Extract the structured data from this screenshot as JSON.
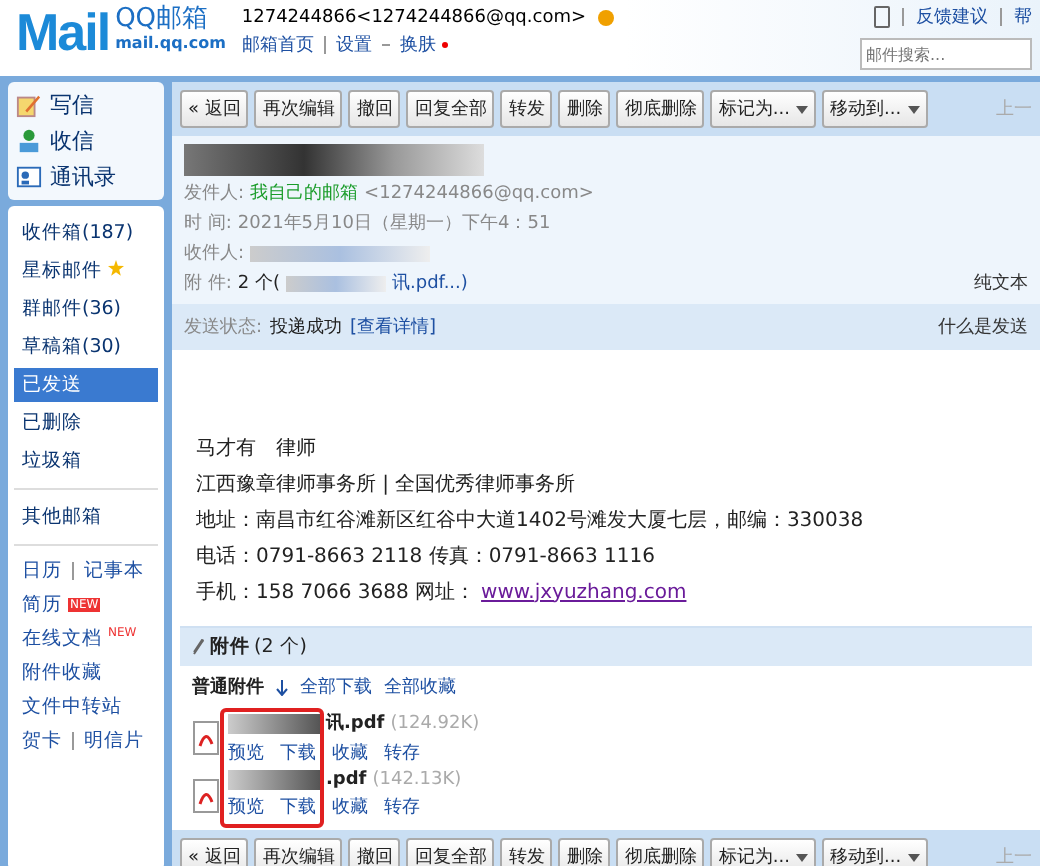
{
  "header": {
    "logo": "Mail",
    "brand": "QQ邮箱",
    "domain": "mail.qq.com",
    "account": "1274244866<1274244866@qq.com>",
    "links": [
      "邮箱首页",
      "设置",
      "换肤"
    ],
    "top_links": [
      "反馈建议",
      "帮"
    ],
    "search": {
      "placeholder": "邮件搜索..."
    }
  },
  "sidebar": {
    "actions": [
      {
        "label": "写信",
        "kind": "write"
      },
      {
        "label": "收信",
        "kind": "receive"
      },
      {
        "label": "通讯录",
        "kind": "contacts"
      }
    ],
    "folders": [
      {
        "label": "收件箱(187)",
        "selected": false,
        "starred": false
      },
      {
        "label": "星标邮件",
        "selected": false,
        "starred": true
      },
      {
        "label": "群邮件(36)",
        "selected": false,
        "starred": false
      },
      {
        "label": "草稿箱(30)",
        "selected": false,
        "starred": false
      },
      {
        "label": "已发送",
        "selected": true,
        "starred": false
      },
      {
        "label": "已删除",
        "selected": false,
        "starred": false
      },
      {
        "label": "垃圾箱",
        "selected": false,
        "starred": false
      }
    ],
    "other": "其他邮箱",
    "tools": [
      {
        "links": [
          "日历",
          "记事本"
        ]
      },
      {
        "links": [
          "简历"
        ],
        "badge": {
          "text": "NEW",
          "kind": "box"
        }
      },
      {
        "links": [
          "在线文档"
        ],
        "badge": {
          "text": "NEW",
          "kind": "sup"
        }
      },
      {
        "links": [
          "附件收藏"
        ]
      },
      {
        "links": [
          "文件中转站"
        ]
      },
      {
        "links": [
          "贺卡",
          "明信片"
        ]
      }
    ]
  },
  "toolbars": [
    {
      "buttons": [
        {
          "label": "« 返回",
          "menu": false
        },
        {
          "label": "再次编辑",
          "menu": false
        },
        {
          "label": "撤回",
          "menu": false
        },
        {
          "label": "回复全部",
          "menu": false
        },
        {
          "label": "转发",
          "menu": false
        },
        {
          "label": "删除",
          "menu": false
        },
        {
          "label": "彻底删除",
          "menu": false
        },
        {
          "label": "标记为...",
          "menu": true
        },
        {
          "label": "移动到...",
          "menu": true
        }
      ],
      "nav": "上一"
    },
    {
      "buttons": [
        {
          "label": "« 返回",
          "menu": false
        },
        {
          "label": "再次编辑",
          "menu": false
        },
        {
          "label": "撤回",
          "menu": false
        },
        {
          "label": "回复全部",
          "menu": false
        },
        {
          "label": "转发",
          "menu": false
        },
        {
          "label": "删除",
          "menu": false
        },
        {
          "label": "彻底删除",
          "menu": false
        },
        {
          "label": "标记为...",
          "menu": true
        },
        {
          "label": "移动到...",
          "menu": true
        }
      ],
      "nav": "上一"
    }
  ],
  "mail": {
    "from_label": "发件人:",
    "from_name": "我自己的邮箱",
    "from_addr": "<1274244866@qq.com>",
    "time_label": "时  间:",
    "time": "2021年5月10日（星期一）下午4：51",
    "to_label": "收件人:",
    "att_label": "附  件:",
    "att_count": "2 个(",
    "att_tail": "讯.pdf...)",
    "plain": "纯文本",
    "status_label": "发送状态:",
    "status": "投递成功",
    "status_link": "[查看详情]",
    "status_help": "什么是发送"
  },
  "signature": [
    "马才有　律师",
    "江西豫章律师事务所 | 全国优秀律师事务所",
    "地址：南昌市红谷滩新区红谷中大道1402号滩发大厦七层，邮编：330038",
    "电话：0791-8663 2118  传真：0791-8663 1116"
  ],
  "sig_last": {
    "text": "手机：158 7066 3688    网址：",
    "link": "www.jxyuzhang.com"
  },
  "attachments": {
    "title": "附件",
    "count": "(2 个)",
    "kind_label": "普通附件",
    "download_all": "全部下载",
    "save_all": "全部收藏",
    "files": [
      {
        "name": "讯.pdf",
        "size": "(124.92K)",
        "actions": [
          "预览",
          "下载",
          "收藏",
          "转存"
        ]
      },
      {
        "name": ".pdf",
        "size": "(142.13K)",
        "actions": [
          "预览",
          "下载",
          "收藏",
          "转存"
        ]
      }
    ]
  }
}
